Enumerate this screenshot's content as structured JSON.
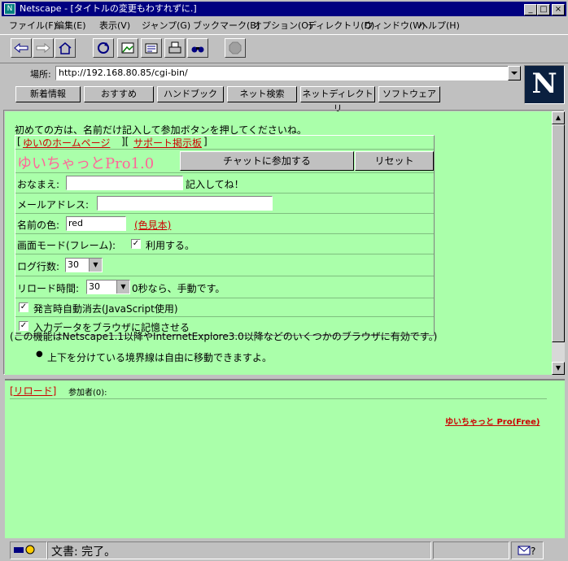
{
  "window": {
    "title": "Netscape - [タイトルの変更もわすれずに.]",
    "min_label": "_",
    "max_label": "□",
    "close_label": "×"
  },
  "menu": [
    "ファイル(F)",
    "編集(E)",
    "表示(V)",
    "ジャンプ(G)",
    "ブックマーク(B)",
    "オプション(O)",
    "ディレクトリ(D)",
    "ウィンドウ(W)",
    "ヘルプ(H)"
  ],
  "toolbar": {
    "icons": [
      "back-icon",
      "forward-icon",
      "home-icon",
      "reload-icon",
      "images-icon",
      "open-icon",
      "print-icon",
      "find-icon",
      "stop-icon"
    ]
  },
  "location": {
    "label": "場所:",
    "url": "http://192.168.80.85/cgi-bin/"
  },
  "directory_buttons": [
    "新着情報",
    "おすすめ",
    "ハンドブック",
    "ネット検索",
    "ネットディレクトリ",
    "ソフトウェア"
  ],
  "logo": "N",
  "top_frame": {
    "intro": "初めての方は、名前だけ記入して参加ボタンを押してくださいね。",
    "bracket_open": "[",
    "bracket_mid": "][",
    "bracket_close": "]",
    "homepage_link": "ゆいのホームページ",
    "support_link": "サポート掲示板",
    "app_title": "ゆいちゃっとPro1.0",
    "join_button": "チャットに参加する",
    "reset_button": "リセット",
    "name_label": "おなまえ:",
    "name_value": "",
    "name_hint": "記入してね！",
    "email_label": "メールアドレス:",
    "email_value": "",
    "color_label": "名前の色:",
    "color_value": "red",
    "color_sample_link": "(色見本)",
    "screen_mode_label": "画面モード(フレーム):",
    "screen_mode_checked": true,
    "screen_mode_text": "利用する。",
    "log_lines_label": "ログ行数:",
    "log_lines_value": "30",
    "reload_label": "リロード時間:",
    "reload_value": "30",
    "reload_suffix": "0秒なら、手動です。",
    "auto_clear_checked": true,
    "auto_clear_text": "発言時自動消去(JavaScript使用)",
    "remember_checked": true,
    "remember_text": "入力データをブラウザに記憶させる",
    "note": "(この機能はNetscape1.1以降やInternetExplore3.0以降などのいくつかのブラウザに有効です。)",
    "bullet": "上下を分けている境界線は自由に移動できますよ。"
  },
  "bottom_frame": {
    "reload_link": "[リロード]",
    "participants": "参加者(0):",
    "credit_link": "ゆいちゃっと Pro(Free)"
  },
  "status": {
    "text": "文書: 完了。"
  },
  "colors": {
    "frame_bg": "#aaffaa",
    "link": "#cc0000",
    "title_pink": "#ff6699",
    "titlebar": "#000080"
  }
}
